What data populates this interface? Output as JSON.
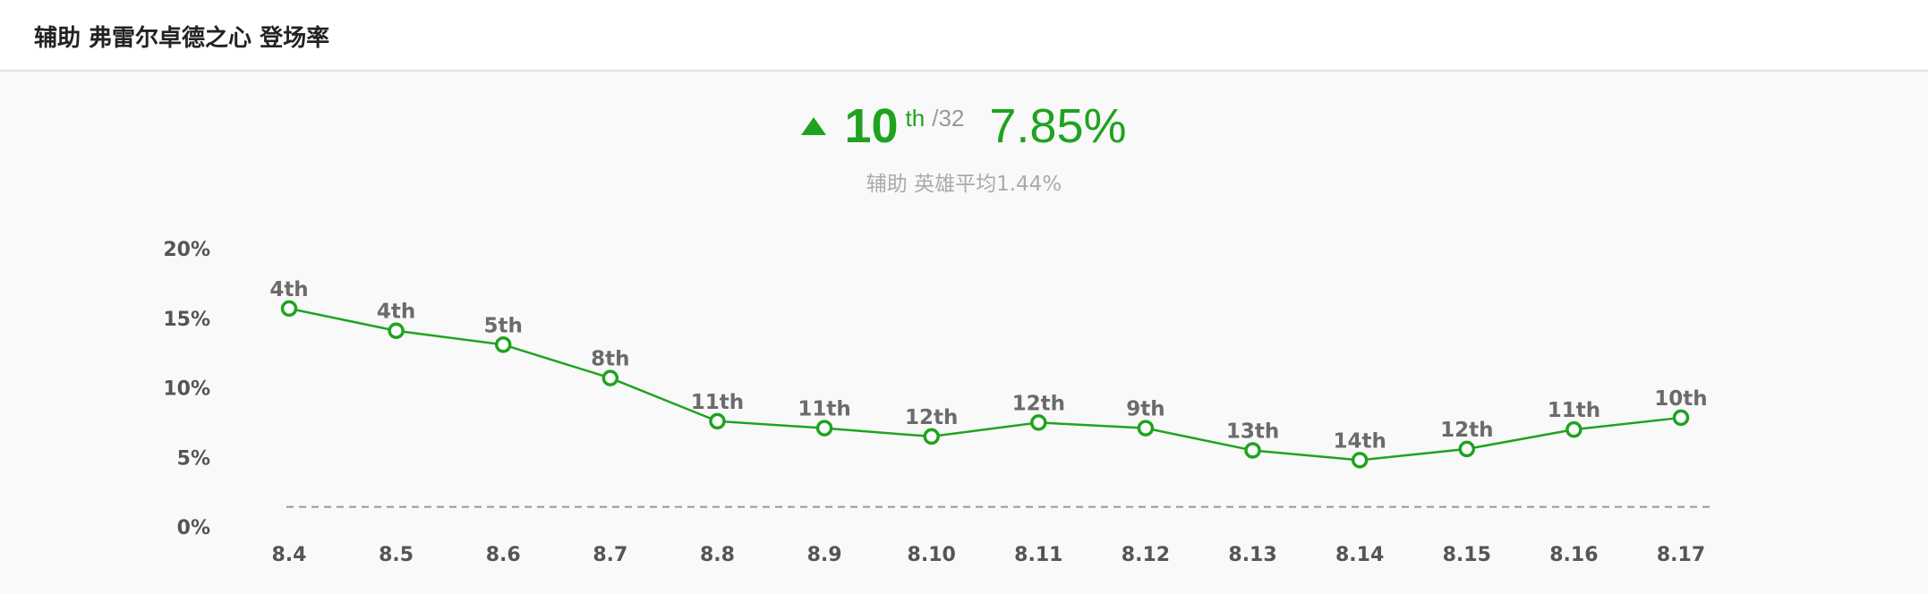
{
  "header": {
    "title": "辅助 弗雷尔卓德之心 登场率"
  },
  "summary": {
    "rank": "10",
    "rank_suffix": "th",
    "rank_total": "/32",
    "rate": "7.85%",
    "avg_text": "辅助 英雄平均1.44%",
    "accent_color": "#1fa31f"
  },
  "chart_data": {
    "type": "line",
    "title": "",
    "xlabel": "",
    "ylabel": "",
    "categories": [
      "8.4",
      "8.5",
      "8.6",
      "8.7",
      "8.8",
      "8.9",
      "8.10",
      "8.11",
      "8.12",
      "8.13",
      "8.14",
      "8.15",
      "8.16",
      "8.17"
    ],
    "series": [
      {
        "values": [
          15.7,
          14.1,
          13.1,
          10.7,
          7.6,
          7.1,
          6.5,
          7.5,
          7.1,
          5.5,
          4.8,
          5.6,
          7.0,
          7.85
        ],
        "labels": [
          "4th",
          "4th",
          "5th",
          "8th",
          "11th",
          "11th",
          "12th",
          "12th",
          "9th",
          "13th",
          "14th",
          "12th",
          "11th",
          "10th"
        ],
        "color": "#1fa31f"
      }
    ],
    "reference_line": {
      "value": 1.44,
      "style": "dashed",
      "color": "#999999"
    },
    "y_ticks": [
      "0%",
      "5%",
      "10%",
      "15%",
      "20%"
    ],
    "ylim": [
      0,
      20
    ],
    "grid": false,
    "legend": "none"
  }
}
